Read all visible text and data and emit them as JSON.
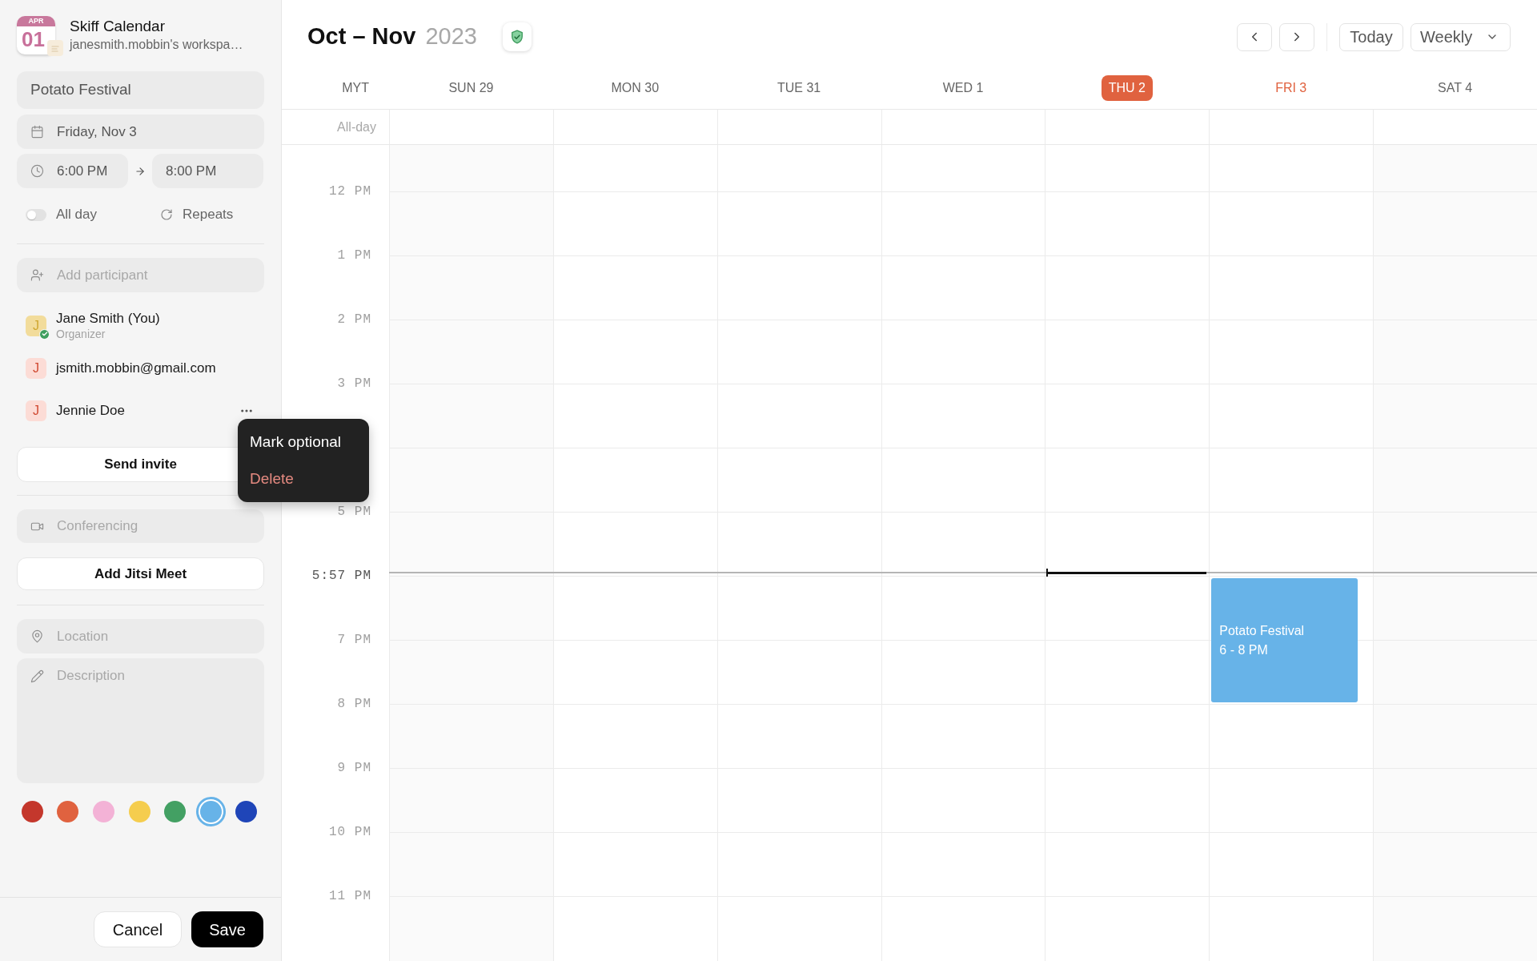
{
  "app": {
    "logo": {
      "month": "APR",
      "day": "01"
    },
    "name": "Skiff Calendar",
    "workspace": "janesmith.mobbin's workspa…"
  },
  "event_form": {
    "title_field": {
      "value": "Potato Festival"
    },
    "date_field": {
      "value": "Friday, Nov 3"
    },
    "start_time_field": {
      "value": "6:00 PM"
    },
    "end_time_field": {
      "value": "8:00 PM"
    },
    "all_day": {
      "label": "All day",
      "on": false
    },
    "repeats_button": {
      "label": "Repeats"
    },
    "participant_field": {
      "placeholder": "Add participant"
    },
    "participants": [
      {
        "initial": "J",
        "color": "#f2dc9b",
        "accepted": true,
        "name": "Jane Smith (You)",
        "role": "Organizer",
        "menu_open": false
      },
      {
        "initial": "J",
        "color": "#fcdcd6",
        "accepted": false,
        "name": "jsmith.mobbin@gmail.com",
        "menu_open": false
      },
      {
        "initial": "J",
        "color": "#fcdcd6",
        "accepted": false,
        "name": "Jennie Doe",
        "menu_open": true
      }
    ],
    "participant_menu": [
      {
        "label": "Mark optional",
        "kind": "normal"
      },
      {
        "label": "Delete",
        "kind": "danger"
      }
    ],
    "send_invite_button": {
      "label": "Send invite"
    },
    "conferencing_field": {
      "placeholder": "Conferencing"
    },
    "jitsi_button": {
      "label": "Add Jitsi Meet"
    },
    "location_field": {
      "placeholder": "Location"
    },
    "description_field": {
      "placeholder": "Description"
    },
    "colors": [
      {
        "color": "#c4372c",
        "selected": false
      },
      {
        "color": "#e0623f",
        "selected": false
      },
      {
        "color": "#f3b2d6",
        "selected": false
      },
      {
        "color": "#f5cd4e",
        "selected": false
      },
      {
        "color": "#43a063",
        "selected": false
      },
      {
        "color": "#67b3e8",
        "selected": true
      },
      {
        "color": "#1f45b8",
        "selected": false
      }
    ],
    "cancel_button": {
      "label": "Cancel"
    },
    "save_button": {
      "label": "Save"
    }
  },
  "calendar": {
    "title": {
      "range": "Oct – Nov",
      "year": "2023"
    },
    "today_button": {
      "label": "Today"
    },
    "view_select": {
      "value": "Weekly"
    },
    "timezone": "MYT",
    "days": [
      {
        "label": "SUN 29",
        "today": false,
        "selected": false,
        "weekend": true
      },
      {
        "label": "MON 30",
        "today": false,
        "selected": false,
        "weekend": false
      },
      {
        "label": "TUE 31",
        "today": false,
        "selected": false,
        "weekend": false
      },
      {
        "label": "WED 1",
        "today": false,
        "selected": false,
        "weekend": false
      },
      {
        "label": "THU 2",
        "today": true,
        "selected": false,
        "weekend": false
      },
      {
        "label": "FRI 3",
        "today": false,
        "selected": true,
        "weekend": false,
        "events": [
          {
            "title": "Potato Festival",
            "time": "6 - 8 PM",
            "color": "#67b3e8"
          }
        ]
      },
      {
        "label": "SAT 4",
        "today": false,
        "selected": false,
        "weekend": true
      }
    ],
    "all_day_label": "All-day",
    "time_axis": [
      {
        "label": "12 PM",
        "kind": "hour"
      },
      {
        "label": "1 PM",
        "kind": "hour"
      },
      {
        "label": "2 PM",
        "kind": "hour"
      },
      {
        "label": "3 PM",
        "kind": "hour"
      },
      {
        "kind": "hour"
      },
      {
        "label": "5 PM",
        "kind": "hour"
      },
      {
        "label": "5:57 PM",
        "kind": "current"
      },
      {
        "label": "7 PM",
        "kind": "hour"
      },
      {
        "label": "8 PM",
        "kind": "hour"
      },
      {
        "label": "9 PM",
        "kind": "hour"
      },
      {
        "label": "10 PM",
        "kind": "hour"
      },
      {
        "label": "11 PM",
        "kind": "hour"
      }
    ]
  }
}
